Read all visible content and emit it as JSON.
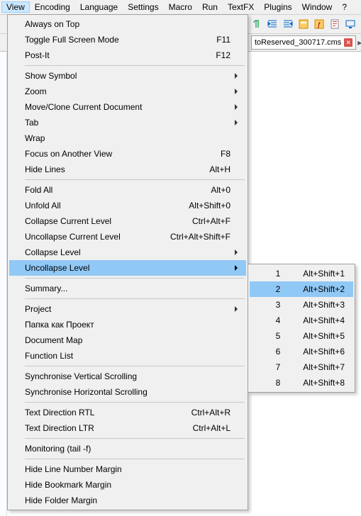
{
  "menubar": {
    "view": "View",
    "encoding": "Encoding",
    "language": "Language",
    "settings": "Settings",
    "macro": "Macro",
    "run": "Run",
    "textfx": "TextFX",
    "plugins": "Plugins",
    "window": "Window",
    "help": "?"
  },
  "tab": {
    "title": "toReserved_300717.cms"
  },
  "viewmenu": {
    "always_on_top": "Always on Top",
    "toggle_full_screen": "Toggle Full Screen Mode",
    "toggle_full_screen_sc": "F11",
    "post_it": "Post-It",
    "post_it_sc": "F12",
    "show_symbol": "Show Symbol",
    "zoom": "Zoom",
    "move_clone": "Move/Clone Current Document",
    "tab": "Tab",
    "wrap": "Wrap",
    "focus_another": "Focus on Another View",
    "focus_another_sc": "F8",
    "hide_lines": "Hide Lines",
    "hide_lines_sc": "Alt+H",
    "fold_all": "Fold All",
    "fold_all_sc": "Alt+0",
    "unfold_all": "Unfold All",
    "unfold_all_sc": "Alt+Shift+0",
    "collapse_current": "Collapse Current Level",
    "collapse_current_sc": "Ctrl+Alt+F",
    "uncollapse_current": "Uncollapse Current Level",
    "uncollapse_current_sc": "Ctrl+Alt+Shift+F",
    "collapse_level": "Collapse Level",
    "uncollapse_level": "Uncollapse Level",
    "summary": "Summary...",
    "project": "Project",
    "folder_as_project": "Папка как Проект",
    "document_map": "Document Map",
    "function_list": "Function List",
    "sync_v": "Synchronise Vertical Scrolling",
    "sync_h": "Synchronise Horizontal Scrolling",
    "rtl": "Text Direction RTL",
    "rtl_sc": "Ctrl+Alt+R",
    "ltr": "Text Direction LTR",
    "ltr_sc": "Ctrl+Alt+L",
    "monitoring": "Monitoring (tail -f)",
    "hide_linenum": "Hide Line Number Margin",
    "hide_bookmark": "Hide Bookmark Margin",
    "hide_folder": "Hide Folder Margin"
  },
  "submenu": {
    "items": [
      {
        "n": "1",
        "sc": "Alt+Shift+1"
      },
      {
        "n": "2",
        "sc": "Alt+Shift+2"
      },
      {
        "n": "3",
        "sc": "Alt+Shift+3"
      },
      {
        "n": "4",
        "sc": "Alt+Shift+4"
      },
      {
        "n": "5",
        "sc": "Alt+Shift+5"
      },
      {
        "n": "6",
        "sc": "Alt+Shift+6"
      },
      {
        "n": "7",
        "sc": "Alt+Shift+7"
      },
      {
        "n": "8",
        "sc": "Alt+Shift+8"
      }
    ]
  }
}
